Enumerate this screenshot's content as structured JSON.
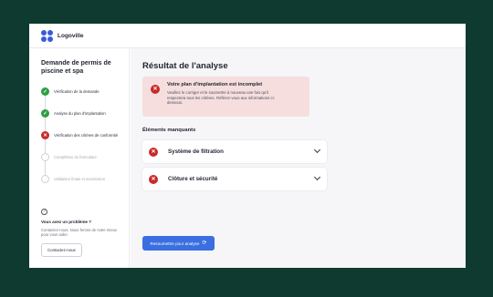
{
  "brand": {
    "name": "Logoville"
  },
  "sidebar": {
    "title": "Demande de permis de piscine et spa",
    "steps": [
      {
        "label": "Vérification de la demande",
        "status": "done"
      },
      {
        "label": "Analyse du plan d'implantation",
        "status": "done"
      },
      {
        "label": "Vérification des critères de conformité",
        "status": "error"
      },
      {
        "label": "Complétion du formulaire",
        "status": "pending"
      },
      {
        "label": "Validation finale et soumission",
        "status": "pending"
      }
    ],
    "help": {
      "title": "Vous avez un problème ?",
      "text": "Contactez-nous. Nous ferons de notre mieux pour vous aider.",
      "button": "Contactez-nous"
    }
  },
  "main": {
    "title": "Résultat de l'analyse",
    "alert": {
      "title": "Votre plan d'implantation est incomplet",
      "text": "Veuillez le corriger et le soumettre à nouveau une fois qu'il respectera tous les critères. Référez-vous aux informations ci-dessous."
    },
    "missing_title": "Éléments manquants",
    "missing_items": [
      {
        "label": "Système de filtration"
      },
      {
        "label": "Clôture et sécurité"
      }
    ],
    "submit_button": "Resoumettre pour analyse"
  },
  "colors": {
    "background": "#0f3a2f",
    "accent": "#3b6fe0",
    "success": "#2f9e44",
    "error": "#c92a2a",
    "alert_bg": "#f6dede"
  }
}
